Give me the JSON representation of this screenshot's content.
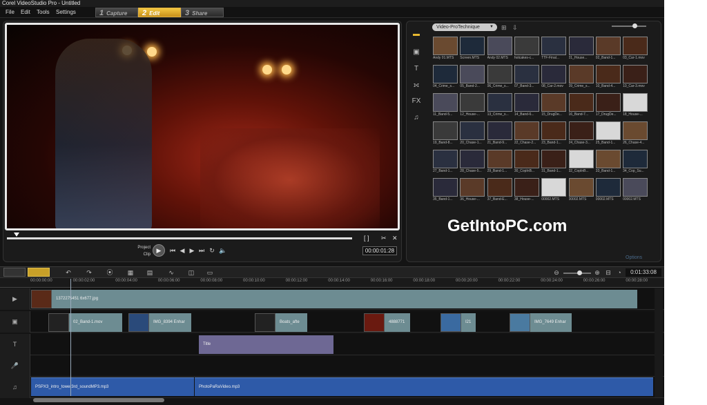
{
  "app": {
    "title": "Corel VideoStudio Pro - Untitled"
  },
  "menu": {
    "file": "File",
    "edit": "Edit",
    "tools": "Tools",
    "settings": "Settings"
  },
  "steps": [
    {
      "num": "1",
      "label": "Capture"
    },
    {
      "num": "2",
      "label": "Edit"
    },
    {
      "num": "3",
      "label": "Share"
    }
  ],
  "player": {
    "mode_project": "Project",
    "mode_clip": "Clip",
    "timecode": "00:00:01:28"
  },
  "library": {
    "folder": "Video-ProTechnique",
    "options": "Options",
    "thumbs": [
      "Andy 01.MTS",
      "Screen.MTS",
      "Andy 02.MTS",
      "hotcakes-c...",
      "TTF-Final...",
      "01_House...",
      "02_Band-1...",
      "03_Car-1.mov",
      "04_Crime_s...",
      "05_Band-2...",
      "06_Crime_s...",
      "07_Band-3...",
      "08_Car-2.mov",
      "09_Crime_s...",
      "10_Band-4...",
      "10_Car-3.mov",
      "11_Band-5...",
      "12_House-...",
      "13_Crime_s...",
      "14_Band-6...",
      "15_DrugDe...",
      "16_Band-7...",
      "17_DrugDe...",
      "18_House-...",
      "19_Band-8...",
      "20_Chase-1...",
      "21_Band-9...",
      "22_Chase-2...",
      "23_Band-1...",
      "24_Chase-3...",
      "25_Band-1...",
      "26_Chase-4...",
      "27_Band-1...",
      "28_Chase-5...",
      "29_Band-1...",
      "30_CopInB...",
      "31_Band-1...",
      "32_CopInB...",
      "33_Band-1...",
      "34_Cop_Su...",
      "35_Band-1...",
      "36_House-...",
      "37_Band-E...",
      "38_House-...",
      "00002.MTS",
      "00002.MTS",
      "00002.MTS",
      "00002.MTS"
    ]
  },
  "watermark": "GetIntoPC.com",
  "timeline": {
    "total_time": "0:01:33:08",
    "ruler": [
      "00:00:00:00",
      "00:00:02:00",
      "00:00:04:00",
      "00:00:06:00",
      "00:00:08:00",
      "00:00:10:00",
      "00:00:12:00",
      "00:00:14:00",
      "00:00:16:00",
      "00:00:18:00",
      "00:00:20:00",
      "00:00:22:00",
      "00:00:24:00",
      "00:00:26:00",
      "00:00:28:00"
    ],
    "video_clip": "1372275451 6x677.jpg",
    "overlay_clips": [
      "02_Band-1.mov",
      "IMG_8394 Enhar",
      "Boats_afte",
      "4888771",
      "I21",
      "IMG_7649 Enhar"
    ],
    "title_clip": "Title",
    "audio_clips": [
      "PSPX3_intro_tower3rd_soundMP3.mp3",
      "PhotoPaRaVideo.mp3"
    ]
  },
  "colors": {
    "accent": "#e8b830",
    "timeline_clip": "#6d8c92",
    "title_clip": "#6e6894",
    "audio_clip": "#2e5aa8"
  }
}
